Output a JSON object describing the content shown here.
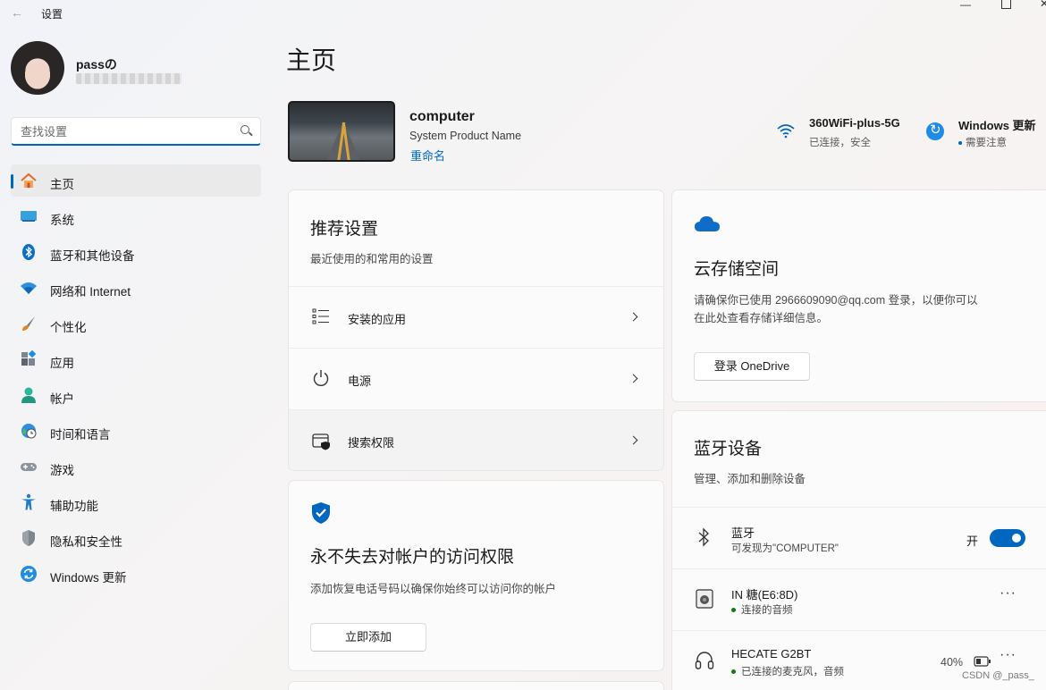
{
  "window": {
    "title": "设置"
  },
  "user": {
    "name": "passの"
  },
  "search": {
    "placeholder": "查找设置"
  },
  "nav": [
    {
      "label": "主页",
      "icon": "home-icon",
      "active": true
    },
    {
      "label": "系统",
      "icon": "monitor-icon"
    },
    {
      "label": "蓝牙和其他设备",
      "icon": "bluetooth-icon"
    },
    {
      "label": "网络和 Internet",
      "icon": "wifi-icon"
    },
    {
      "label": "个性化",
      "icon": "brush-icon"
    },
    {
      "label": "应用",
      "icon": "apps-icon"
    },
    {
      "label": "帐户",
      "icon": "account-icon"
    },
    {
      "label": "时间和语言",
      "icon": "globe-clock-icon"
    },
    {
      "label": "游戏",
      "icon": "gamepad-icon"
    },
    {
      "label": "辅助功能",
      "icon": "accessibility-icon"
    },
    {
      "label": "隐私和安全性",
      "icon": "shield-icon"
    },
    {
      "label": "Windows 更新",
      "icon": "update-icon"
    }
  ],
  "main": {
    "title": "主页",
    "device": {
      "name": "computer",
      "model": "System Product Name",
      "rename": "重命名"
    },
    "wifi": {
      "name": "360WiFi-plus-5G",
      "state": "已连接，安全"
    },
    "update": {
      "name": "Windows 更新",
      "state": "需要注意"
    },
    "recommended": {
      "title": "推荐设置",
      "subtitle": "最近使用的和常用的设置",
      "rows": [
        {
          "label": "安装的应用",
          "icon": "list-icon"
        },
        {
          "label": "电源",
          "icon": "power-icon"
        },
        {
          "label": "搜索权限",
          "icon": "search-permission-icon"
        }
      ]
    },
    "account_card": {
      "title": "永不失去对帐户的访问权限",
      "subtitle": "添加恢复电话号码以确保你始终可以访问你的帐户",
      "button": "立即添加"
    },
    "cloud": {
      "title": "云存储空间",
      "text1": "请确保你已使用 2966609090@qq.com 登录，以便你可以",
      "text2": "在此处查看存储详细信息。",
      "button": "登录 OneDrive"
    },
    "bluetooth": {
      "title": "蓝牙设备",
      "subtitle": "管理、添加和删除设备",
      "toggle_name": "蓝牙",
      "toggle_sub": "可发现为\"COMPUTER\"",
      "toggle_state": "开",
      "devices": [
        {
          "name": "IN 糖(E6:8D)",
          "status": "连接的音频",
          "icon": "speaker-icon"
        },
        {
          "name": "HECATE G2BT",
          "status": "已连接的麦克风，音频",
          "battery": "40%",
          "icon": "headphones-icon"
        }
      ]
    }
  },
  "watermark": "CSDN @_pass_",
  "colors": {
    "accent": "#0067c0",
    "status_green": "#0f7b0f"
  }
}
